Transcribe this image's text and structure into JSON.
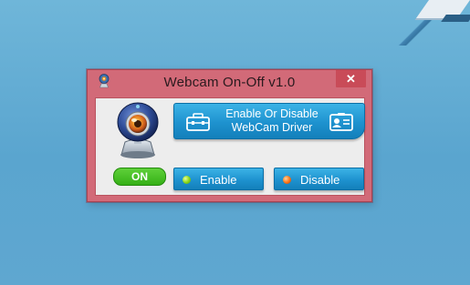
{
  "window": {
    "title": "Webcam On-Off v1.0",
    "close_glyph": "✕",
    "app_icon": "webcam-app-icon"
  },
  "status": {
    "label": "ON",
    "color": "#35b016"
  },
  "buttons": {
    "driver": {
      "label_line1": "Enable Or Disable",
      "label_line2": "WebCam Driver",
      "left_icon": "toolbox-icon",
      "right_icon": "id-card-icon"
    },
    "enable": {
      "label": "Enable",
      "indicator_color": "#8fd81e"
    },
    "disable": {
      "label": "Disable",
      "indicator_color": "#ff7a1c"
    }
  },
  "colors": {
    "accent_blue": "#1e92cf",
    "window_frame": "#d26a78",
    "close_button": "#c94b58",
    "desktop": "#6fb6d9"
  }
}
